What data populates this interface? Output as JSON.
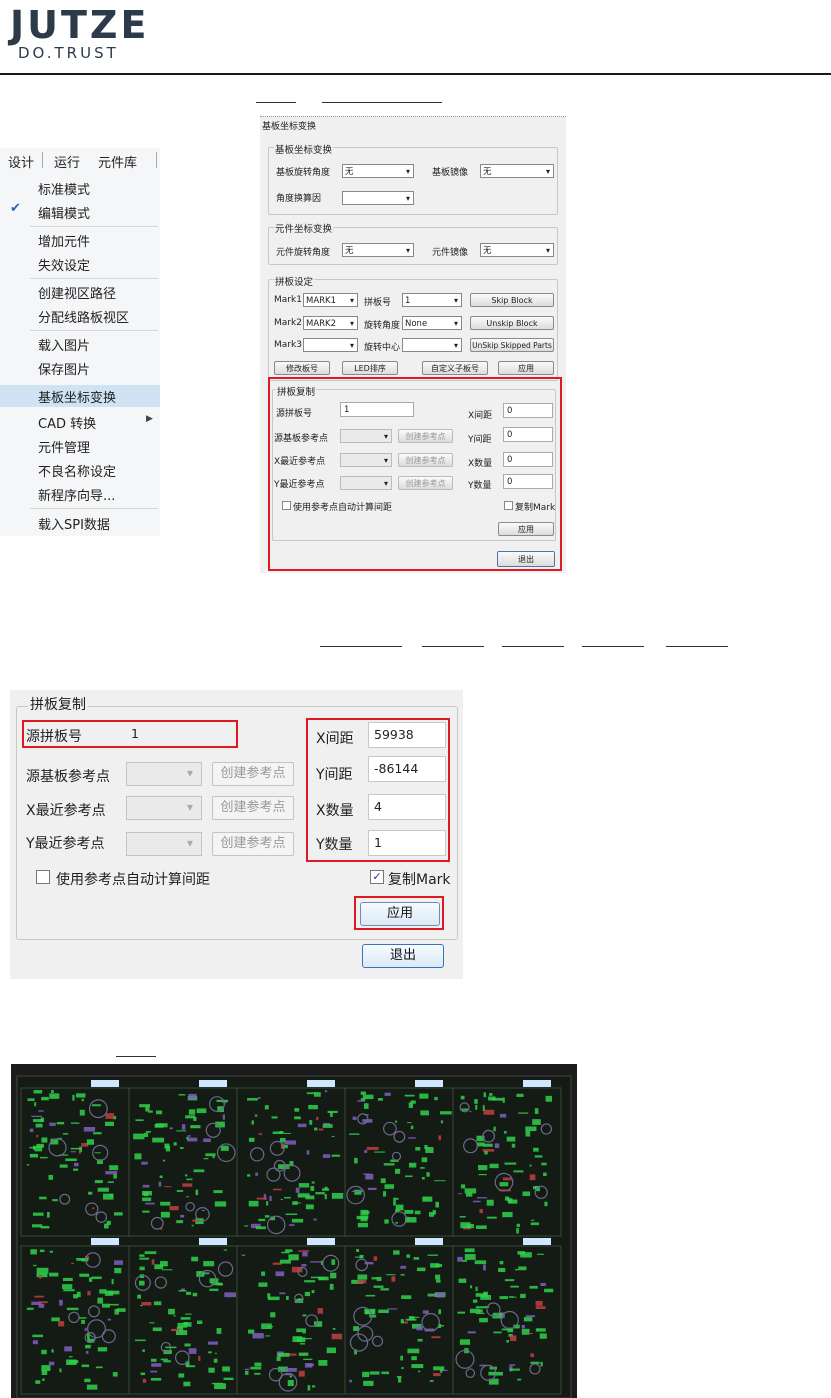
{
  "header": {
    "logo": "JUTZE",
    "tagline": "DO.TRUST"
  },
  "menu": {
    "bar": [
      "设计",
      "运行",
      "元件库"
    ],
    "items": [
      {
        "label": "标准模式",
        "checked": false
      },
      {
        "label": "编辑模式",
        "checked": true
      },
      {
        "label": "增加元件",
        "checked": false
      },
      {
        "label": "失效设定",
        "checked": false
      },
      {
        "label": "创建视区路径",
        "checked": false
      },
      {
        "label": "分配线路板视区",
        "checked": false
      },
      {
        "label": "载入图片",
        "checked": false
      },
      {
        "label": "保存图片",
        "checked": false
      },
      {
        "label": "基板坐标变换",
        "checked": false,
        "highlighted": true
      },
      {
        "label": "CAD 转换",
        "checked": false,
        "submenu": true
      },
      {
        "label": "元件管理",
        "checked": false
      },
      {
        "label": "不良名称设定",
        "checked": false
      },
      {
        "label": "新程序向导...",
        "checked": false
      },
      {
        "label": "载入SPI数据",
        "checked": false
      }
    ]
  },
  "dialog": {
    "title": "基板坐标变换",
    "board_group": {
      "title": "基板坐标变换",
      "rotate_label": "基板旋转角度",
      "rotate_value": "无",
      "mirror_label": "基板镜像",
      "mirror_value": "无",
      "angle_label": "角度换算因",
      "angle_value": ""
    },
    "part_group": {
      "title": "元件坐标变换",
      "rotate_label": "元件旋转角度",
      "rotate_value": "无",
      "mirror_label": "元件镜像",
      "mirror_value": "无"
    },
    "panel_group": {
      "title": "拼板设定",
      "mark1_label": "Mark1",
      "mark1_value": "MARK1",
      "mark2_label": "Mark2",
      "mark2_value": "MARK2",
      "mark3_label": "Mark3",
      "mark3_value": "",
      "panel_no_label": "拼板号",
      "panel_no_value": "1",
      "rot_angle_label": "旋转角度",
      "rot_angle_value": "None",
      "rot_center_label": "旋转中心",
      "rot_center_value": "",
      "skip_block": "Skip Block",
      "unskip_block": "Unskip Block",
      "unskip_parts": "UnSkip Skipped Parts",
      "modify_no": "修改板号",
      "led_sort": "LED排序",
      "custom_sub": "自定义子板号",
      "apply": "应用"
    },
    "copy_group": {
      "title": "拼板复制",
      "src_panel_label": "源拼板号",
      "src_panel_value": "1",
      "src_ref_label": "源基板参考点",
      "x_near_label": "X最近参考点",
      "y_near_label": "Y最近参考点",
      "create_ref": "创建参考点",
      "x_pitch_label": "X间距",
      "x_pitch_value": "0",
      "y_pitch_label": "Y间距",
      "y_pitch_value": "0",
      "x_count_label": "X数量",
      "x_count_value": "0",
      "y_count_label": "Y数量",
      "y_count_value": "0",
      "auto_calc_label": "使用参考点自动计算间距",
      "copy_mark_label": "复制Mark",
      "apply": "应用",
      "exit": "退出"
    }
  },
  "zoom": {
    "title": "拼板复制",
    "src_panel_label": "源拼板号",
    "src_panel_value": "1",
    "src_ref_label": "源基板参考点",
    "x_near_label": "X最近参考点",
    "y_near_label": "Y最近参考点",
    "create_ref": "创建参考点",
    "x_pitch_label": "X间距",
    "x_pitch_value": "59938",
    "y_pitch_label": "Y间距",
    "y_pitch_value": "-86144",
    "x_count_label": "X数量",
    "x_count_value": "4",
    "y_count_label": "Y数量",
    "y_count_value": "1",
    "auto_calc_label": "使用参考点自动计算间距",
    "copy_mark_label": "复制Mark",
    "copy_mark_checked": true,
    "apply": "应用",
    "exit": "退出"
  },
  "colors": {
    "highlight_red": "#e01a22",
    "menu_highlight": "#cfe3f5",
    "pcb_bg": "#1c1c1c",
    "pcb_trace": "#2fd14a",
    "pcb_label": "#cfe8ff"
  }
}
